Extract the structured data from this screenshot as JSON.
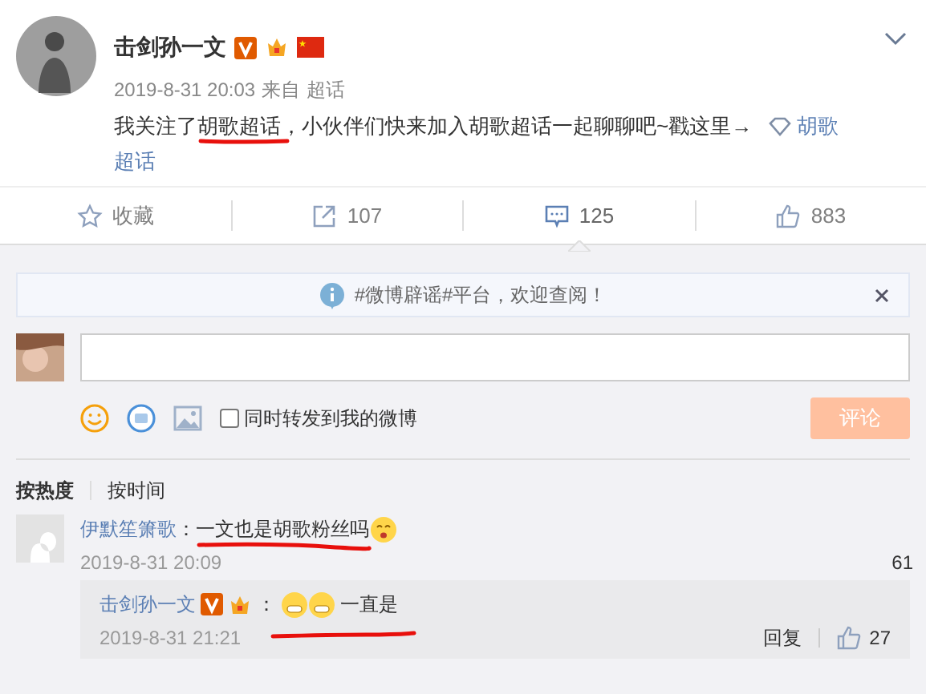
{
  "post": {
    "author": "击剑孙一文",
    "time": "2019-8-31 20:03",
    "source_label": "来自",
    "source": "超话",
    "text_before": "我关注了",
    "text_highlight": "胡歌超话",
    "text_after": "，小伙伴们快来加入胡歌超话一起聊聊吧~戳这里→",
    "link_line1": "胡歌",
    "link_line2": "超话"
  },
  "actions": [
    {
      "kind": "star",
      "label": "收藏",
      "selected": false
    },
    {
      "kind": "share",
      "label": "107",
      "selected": false
    },
    {
      "kind": "comment",
      "label": "125",
      "selected": true
    },
    {
      "kind": "like",
      "label": "883",
      "selected": false
    }
  ],
  "notice": {
    "text": "#微博辟谣#平台，欢迎查阅！"
  },
  "composer": {
    "repost_label": "同时转发到我的微博",
    "repost_checked": false,
    "submit": "评论"
  },
  "sort_tabs": [
    {
      "label": "按热度",
      "selected": true
    },
    {
      "label": "按时间",
      "selected": false
    }
  ],
  "comments": [
    {
      "author": "伊默笙箫歌",
      "colon": "：",
      "text": "一文也是胡歌粉丝吗",
      "time": "2019-8-31 20:09",
      "likes": "61",
      "replies": [
        {
          "author": "击剑孙一文",
          "colon": "：",
          "text": "一直是",
          "time": "2019-8-31 21:21",
          "reply_label": "回复",
          "likes": "27"
        }
      ]
    }
  ]
}
